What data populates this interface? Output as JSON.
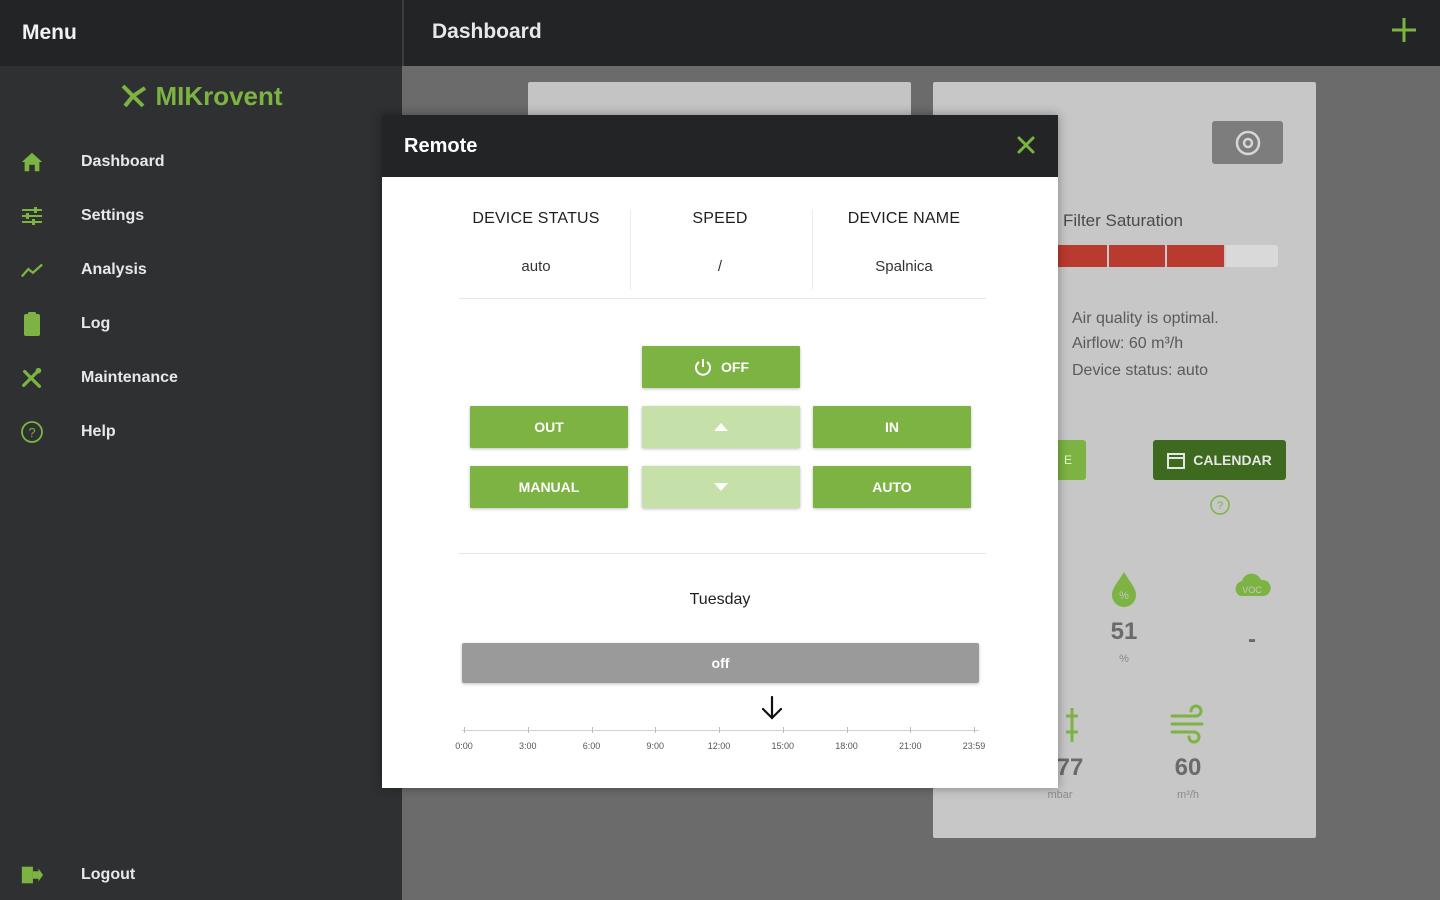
{
  "sidebar": {
    "header": "Menu",
    "logo_text": "MIKrovent",
    "items": [
      {
        "label": "Dashboard",
        "icon": "home-icon"
      },
      {
        "label": "Settings",
        "icon": "sliders-icon"
      },
      {
        "label": "Analysis",
        "icon": "chart-line-icon"
      },
      {
        "label": "Log",
        "icon": "clipboard-icon"
      },
      {
        "label": "Maintenance",
        "icon": "tools-icon"
      },
      {
        "label": "Help",
        "icon": "help-circle-icon"
      }
    ],
    "logout": {
      "label": "Logout",
      "icon": "logout-icon"
    }
  },
  "topbar": {
    "title": "Dashboard",
    "add_icon": "plus-icon"
  },
  "device_card": {
    "filter_label": "Filter Saturation",
    "status_lines": [
      "Air quality is optimal.",
      "Airflow: 60 m³/h",
      "Device status: auto"
    ],
    "calendar_button": "CALENDAR",
    "partial_button": "E",
    "sensors": [
      {
        "value": "51",
        "unit": "%"
      },
      {
        "value": "-",
        "unit": ""
      },
      {
        "value": "77",
        "unit": "mbar"
      },
      {
        "value": "60",
        "unit": "m³/h"
      }
    ]
  },
  "modal": {
    "title": "Remote",
    "info": [
      {
        "heading": "DEVICE STATUS",
        "value": "auto"
      },
      {
        "heading": "SPEED",
        "value": "/"
      },
      {
        "heading": "DEVICE NAME",
        "value": "Spalnica"
      }
    ],
    "buttons": {
      "off": "OFF",
      "out": "OUT",
      "in": "IN",
      "manual": "MANUAL",
      "auto": "AUTO"
    },
    "day": "Tuesday",
    "schedule_state": "off",
    "timeline_labels": [
      "0:00",
      "3:00",
      "6:00",
      "9:00",
      "12:00",
      "15:00",
      "18:00",
      "21:00",
      "23:59"
    ]
  },
  "colors": {
    "accent": "#7cb342",
    "accent_light": "#c5e0a8",
    "dark": "#222425",
    "sidebar": "#2e3031",
    "filter_red": "#b93a2e"
  }
}
